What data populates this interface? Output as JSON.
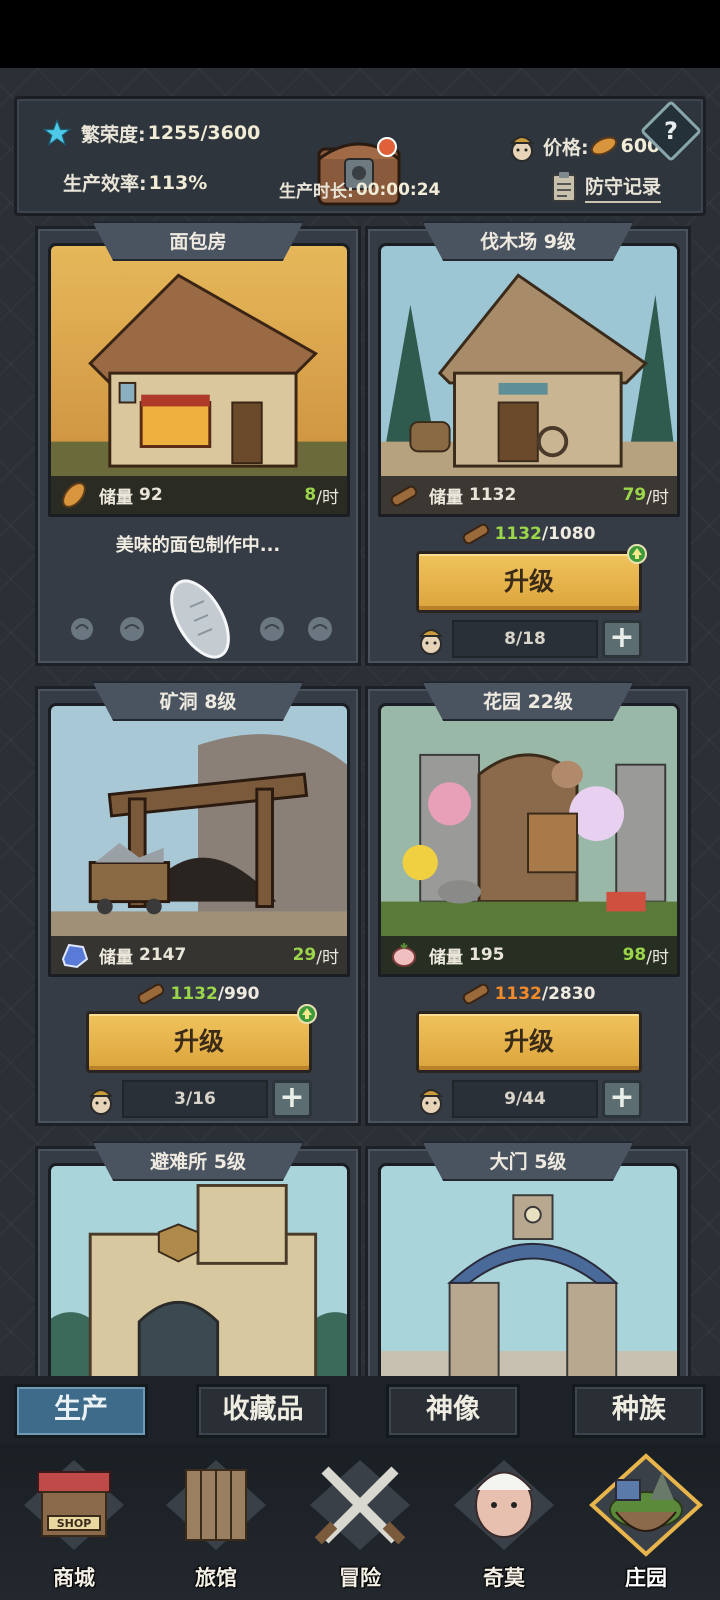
{
  "header": {
    "prosperity_label": "繁荣度:",
    "prosperity_value": "1255/3600",
    "efficiency_label": "生产效率:",
    "efficiency_value": "113%",
    "duration_label": "生产时长:",
    "duration_value": "00:00:24",
    "price_label": "价格:",
    "price_value": "600",
    "defense_record": "防守记录",
    "help": "?"
  },
  "buildings": [
    {
      "title": "面包房",
      "storage_label": "储量",
      "storage": "92",
      "rate": "8",
      "rate_unit": "/时",
      "status": "美味的面包制作中..."
    },
    {
      "title": "伐木场  9级",
      "storage_label": "储量",
      "storage": "1132",
      "rate": "79",
      "rate_unit": "/时",
      "cost_have": "1132",
      "cost_need": "/1080",
      "upgrade": "升级",
      "workers": "8/18",
      "plus": "+"
    },
    {
      "title": "矿洞  8级",
      "storage_label": "储量",
      "storage": "2147",
      "rate": "29",
      "rate_unit": "/时",
      "cost_have": "1132",
      "cost_need": "/990",
      "upgrade": "升级",
      "workers": "3/16",
      "plus": "+"
    },
    {
      "title": "花园  22级",
      "storage_label": "储量",
      "storage": "195",
      "rate": "98",
      "rate_unit": "/时",
      "cost_have": "1132",
      "cost_need": "/2830",
      "upgrade": "升级",
      "workers": "9/44",
      "plus": "+"
    },
    {
      "title": "避难所  5级"
    },
    {
      "title": "大门  5级"
    }
  ],
  "category_tabs": [
    "生产",
    "收藏品",
    "神像",
    "种族"
  ],
  "active_category": "生产",
  "bottom_nav": [
    "商城",
    "旅馆",
    "冒险",
    "奇莫",
    "庄园"
  ],
  "shop_sign": "SHOP",
  "active_nav": "庄园",
  "colors": {
    "accent_green": "#9bd64a",
    "cost_short_orange": "#f08a2a",
    "upgrade_gold": "#e8b44c",
    "active_tab_blue": "#3f6b8a"
  }
}
